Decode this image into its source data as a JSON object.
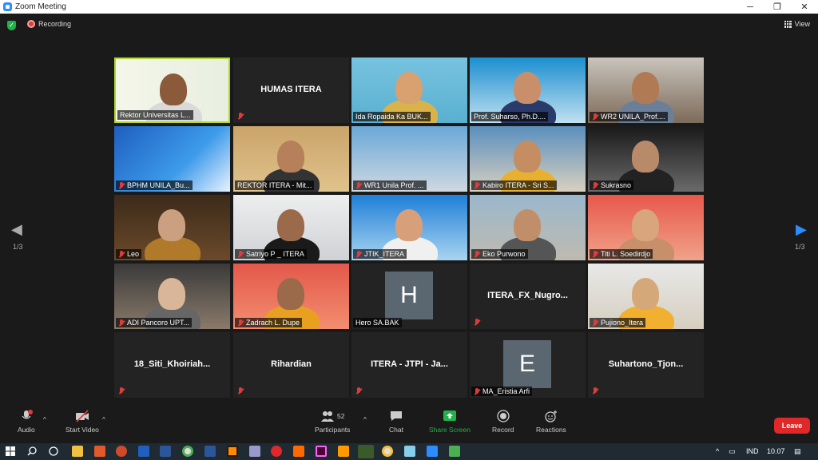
{
  "window": {
    "title": "Zoom Meeting",
    "minimize": "─",
    "maximize": "❐",
    "close": "✕"
  },
  "topbar": {
    "recording_label": "Recording",
    "view_label": "View"
  },
  "nav": {
    "page_left": "1/3",
    "page_right": "1/3",
    "prev_arrow": "◀",
    "next_arrow": "▶"
  },
  "tiles": [
    {
      "name": "Rektor Universitas L...",
      "type": "video",
      "muted": false,
      "active": true
    },
    {
      "name": "HUMAS ITERA",
      "type": "name",
      "muted": true
    },
    {
      "name": "Ida Ropaida Ka BUK...",
      "type": "video",
      "muted": false
    },
    {
      "name": "Prof. Suharso, Ph.D....",
      "type": "video",
      "muted": false
    },
    {
      "name": "WR2 UNILA_Prof....",
      "type": "video",
      "muted": true
    },
    {
      "name": "BPHM UNILA_Bu...",
      "type": "video",
      "muted": true
    },
    {
      "name": "REKTOR ITERA - Mit...",
      "type": "video",
      "muted": false
    },
    {
      "name": "WR1 Unila Prof. ...",
      "type": "video",
      "muted": true
    },
    {
      "name": "Kabiro ITERA - Sri S...",
      "type": "video",
      "muted": true
    },
    {
      "name": "Sukrasno",
      "type": "video",
      "muted": true
    },
    {
      "name": "Leo",
      "type": "video",
      "muted": true
    },
    {
      "name": "Satriyo P _ ITERA",
      "type": "video",
      "muted": true
    },
    {
      "name": "JTIK_ITERA",
      "type": "video",
      "muted": true
    },
    {
      "name": "Eko Purwono",
      "type": "video",
      "muted": true
    },
    {
      "name": "Titi L. Soedirdjo",
      "type": "video",
      "muted": true
    },
    {
      "name": "ADI Pancoro UPT...",
      "type": "video",
      "muted": true
    },
    {
      "name": "Zadrach L. Dupe",
      "type": "video",
      "muted": true
    },
    {
      "name": "Hero SA.BAK",
      "type": "avatar",
      "initial": "H",
      "muted": false
    },
    {
      "name": "ITERA_FX_Nugro...",
      "type": "name",
      "muted": true
    },
    {
      "name": "Pujiono_Itera",
      "type": "video",
      "muted": true
    },
    {
      "name": "18_Siti_Khoiriah...",
      "type": "name",
      "muted": true
    },
    {
      "name": "Rihardian",
      "type": "name",
      "muted": true
    },
    {
      "name": "ITERA - JTPI - Ja...",
      "type": "name",
      "muted": true
    },
    {
      "name": "MA_Eristia Arfi",
      "type": "avatar",
      "initial": "E",
      "muted": true
    },
    {
      "name": "Suhartono_Tjon...",
      "type": "name",
      "muted": true
    }
  ],
  "toolbar": {
    "audio": "Audio",
    "video": "Start Video",
    "participants": "Participants",
    "participants_count": "52",
    "chat": "Chat",
    "share": "Share Screen",
    "record": "Record",
    "reactions": "Reactions",
    "leave": "Leave"
  },
  "taskbar": {
    "language": "IND",
    "time": "10.07"
  },
  "colors": {
    "accent_green": "#b3d72c",
    "share_green": "#22b14c",
    "leave_red": "#e02828",
    "mute_red": "#e03b3b"
  }
}
